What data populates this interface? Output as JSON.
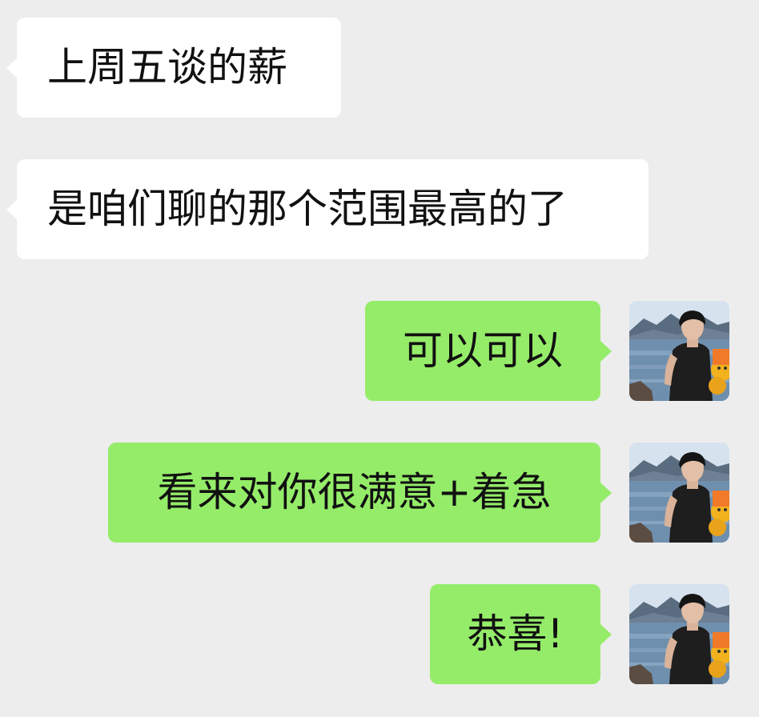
{
  "conversation": {
    "messages": [
      {
        "sender": "contact",
        "text": "上周五谈的薪"
      },
      {
        "sender": "contact",
        "text": "是咱们聊的那个范围最高的了"
      },
      {
        "sender": "self",
        "text": "可以可以"
      },
      {
        "sender": "self",
        "text": "看来对你很满意+着急"
      },
      {
        "sender": "self",
        "text": "恭喜!"
      }
    ]
  },
  "colors": {
    "background": "#ededed",
    "incoming_bubble": "#ffffff",
    "outgoing_bubble": "#95ec69",
    "text": "#111111"
  },
  "icons": {
    "self_avatar": "avatar-photo-icon"
  }
}
